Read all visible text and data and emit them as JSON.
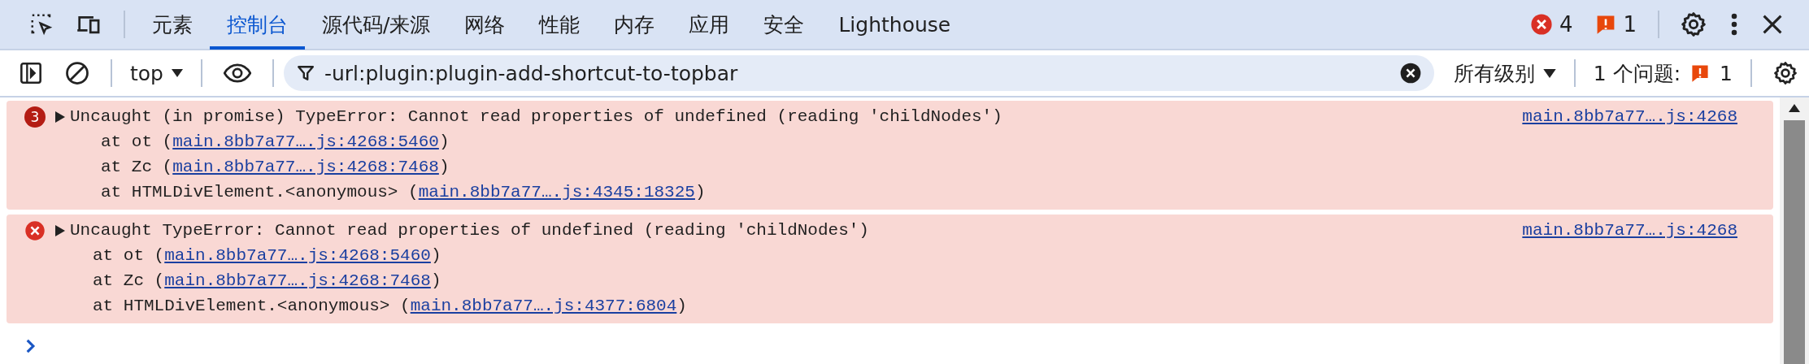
{
  "tabs": [
    {
      "label": "元素",
      "selected": false
    },
    {
      "label": "控制台",
      "selected": true
    },
    {
      "label": "源代码/来源",
      "selected": false
    },
    {
      "label": "网络",
      "selected": false
    },
    {
      "label": "性能",
      "selected": false
    },
    {
      "label": "内存",
      "selected": false
    },
    {
      "label": "应用",
      "selected": false
    },
    {
      "label": "安全",
      "selected": false
    },
    {
      "label": "Lighthouse",
      "selected": false
    }
  ],
  "status": {
    "errors": "4",
    "issues": "1"
  },
  "toolbar": {
    "context": "top",
    "filter": {
      "value": "-url:plugin:plugin-add-shortcut-to-topbar"
    },
    "levels": "所有级别",
    "issues_label": "1 个问题:",
    "issues_count": "1"
  },
  "messages": [
    {
      "kind": "repeat",
      "count": "3",
      "text": "Uncaught (in promise) TypeError: Cannot read properties of undefined (reading 'childNodes')",
      "source": "main.8bb7a77….js:4268",
      "frames": [
        {
          "prefix": "at ot (",
          "link": "main.8bb7a77….js:4268:5460",
          "suffix": ")"
        },
        {
          "prefix": "at Zc (",
          "link": "main.8bb7a77….js:4268:7468",
          "suffix": ")"
        },
        {
          "prefix": "at HTMLDivElement.<anonymous> (",
          "link": "main.8bb7a77….js:4345:18325",
          "suffix": ")"
        }
      ]
    },
    {
      "kind": "single",
      "text": "Uncaught TypeError: Cannot read properties of undefined (reading 'childNodes')",
      "source": "main.8bb7a77….js:4268",
      "frames": [
        {
          "prefix": "at ot (",
          "link": "main.8bb7a77….js:4268:5460",
          "suffix": ")"
        },
        {
          "prefix": "at Zc (",
          "link": "main.8bb7a77….js:4268:7468",
          "suffix": ")"
        },
        {
          "prefix": "at HTMLDivElement.<anonymous> (",
          "link": "main.8bb7a77….js:4377:6804",
          "suffix": ")"
        }
      ]
    }
  ]
}
